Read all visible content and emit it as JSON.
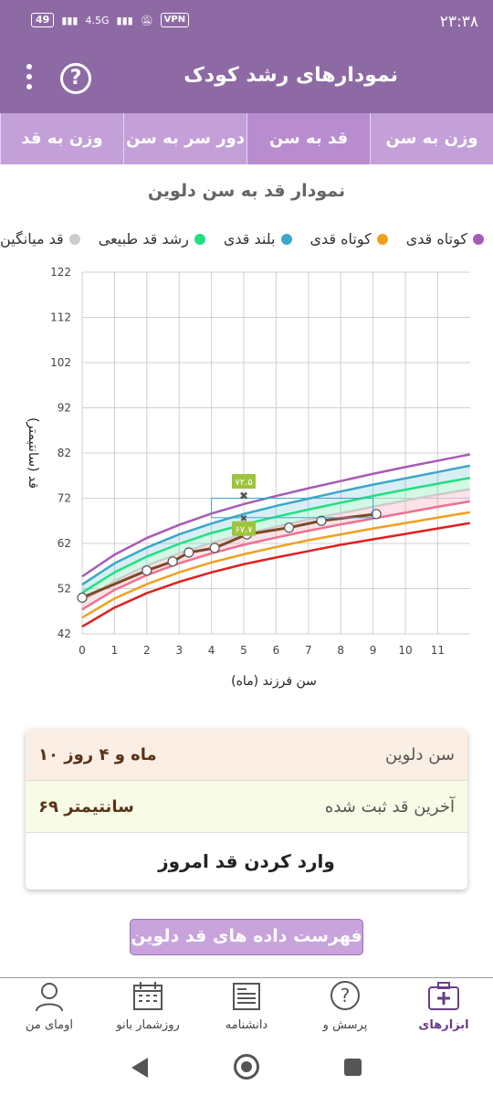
{
  "status_bar": {
    "time": "۲۳:۳۸",
    "battery": "49",
    "network": "4.5G",
    "vpn": "VPN"
  },
  "header": {
    "title": "نمودارهای رشد کودک"
  },
  "tabs": [
    {
      "label": "وزن به سن",
      "active": false
    },
    {
      "label": "قد به سن",
      "active": true
    },
    {
      "label": "دور سر به سن",
      "active": false
    },
    {
      "label": "وزن به قد",
      "active": false
    }
  ],
  "chart_title": "نمودار قد به سن دلوین",
  "legend": [
    {
      "label": "کوتاه قدی",
      "color": "#a65bb5"
    },
    {
      "label": "کوتاه قدی",
      "color": "#f0a020"
    },
    {
      "label": "بلند قدی",
      "color": "#3aa8c8"
    },
    {
      "label": "رشد قد طبیعی",
      "color": "#20e080"
    },
    {
      "label": "قد میانگین",
      "color": "#cccccc"
    }
  ],
  "chart_data": {
    "type": "line",
    "xlabel": "سن فرزند (ماه)",
    "ylabel": "قد (سانتیمتر)",
    "xlim": [
      0,
      12
    ],
    "ylim": [
      42,
      122
    ],
    "x_ticks": [
      "0",
      "1",
      "2",
      "3",
      "4",
      "5",
      "6",
      "7",
      "8",
      "9",
      "10",
      "11"
    ],
    "y_ticks": [
      "42",
      "52",
      "62",
      "72",
      "82",
      "92",
      "102",
      "112",
      "122"
    ],
    "series": [
      {
        "color": "#a65bb5",
        "x": [
          0,
          1,
          2,
          3,
          4,
          5,
          6,
          7,
          8,
          9,
          10,
          11,
          12
        ],
        "y": [
          54.7,
          59.5,
          63.2,
          66.1,
          68.6,
          70.7,
          72.5,
          74.2,
          75.8,
          77.4,
          78.9,
          80.3,
          81.7
        ]
      },
      {
        "color": "#3aa8c8",
        "x": [
          0,
          1,
          2,
          3,
          4,
          5,
          6,
          7,
          8,
          9,
          10,
          11,
          12
        ],
        "y": [
          52.9,
          57.6,
          61.1,
          64.0,
          66.4,
          68.5,
          70.3,
          71.9,
          73.5,
          75.0,
          76.4,
          77.8,
          79.2
        ]
      },
      {
        "color": "#20e080",
        "x": [
          0,
          1,
          2,
          3,
          4,
          5,
          6,
          7,
          8,
          9,
          10,
          11,
          12
        ],
        "y": [
          51.1,
          55.6,
          59.1,
          61.9,
          64.3,
          66.2,
          67.9,
          69.5,
          71.0,
          72.5,
          73.9,
          75.2,
          76.5
        ]
      },
      {
        "color": "#cccccc",
        "x": [
          0,
          1,
          2,
          3,
          4,
          5,
          6,
          7,
          8,
          9,
          10,
          11,
          12
        ],
        "y": [
          49.2,
          53.7,
          57.1,
          59.8,
          62.1,
          64.0,
          65.7,
          67.3,
          68.7,
          70.1,
          71.5,
          72.8,
          74.0
        ]
      },
      {
        "color": "#f07090",
        "x": [
          0,
          1,
          2,
          3,
          4,
          5,
          6,
          7,
          8,
          9,
          10,
          11,
          12
        ],
        "y": [
          47.4,
          51.7,
          55.0,
          57.6,
          59.8,
          61.7,
          63.3,
          64.8,
          66.2,
          67.5,
          68.8,
          70.1,
          71.3
        ]
      },
      {
        "color": "#f0a020",
        "x": [
          0,
          1,
          2,
          3,
          4,
          5,
          6,
          7,
          8,
          9,
          10,
          11,
          12
        ],
        "y": [
          45.6,
          49.8,
          53.0,
          55.6,
          57.8,
          59.6,
          61.2,
          62.7,
          64.0,
          65.3,
          66.5,
          67.7,
          68.9
        ]
      },
      {
        "color": "#e02020",
        "x": [
          0,
          1,
          2,
          3,
          4,
          5,
          6,
          7,
          8,
          9,
          10,
          11,
          12
        ],
        "y": [
          43.6,
          47.8,
          51.0,
          53.5,
          55.6,
          57.4,
          58.9,
          60.3,
          61.7,
          62.9,
          64.1,
          65.3,
          66.5
        ]
      },
      {
        "color": "#7a4a20",
        "x": [
          0,
          2,
          2.8,
          3.3,
          4.1,
          5.1,
          6.4,
          7.4,
          9.1
        ],
        "y": [
          50.0,
          56.0,
          58.0,
          60.0,
          61.0,
          64.0,
          65.5,
          67.0,
          68.5
        ]
      }
    ],
    "marker_labels": [
      "۷۲.۵",
      "۶۷.۷"
    ]
  },
  "info": {
    "age_label": "سن دلوین",
    "age_value": "۱۰ ماه و ۴ روز",
    "height_label": "آخرین قد ثبت شده",
    "height_value": "۶۹ سانتیمتر",
    "enter_button": "وارد کردن قد امروز"
  },
  "list_button": "فهرست داده های قد دلوین",
  "bottom_nav": [
    {
      "label": "ابزارهای",
      "icon": "medical-kit-icon",
      "active": true
    },
    {
      "label": "پرسش و",
      "icon": "question-icon",
      "active": false
    },
    {
      "label": "دانشنامه",
      "icon": "newspaper-icon",
      "active": false
    },
    {
      "label": "روزشمار بانو",
      "icon": "calendar-icon",
      "active": false
    },
    {
      "label": "اومای من",
      "icon": "profile-icon",
      "active": false
    }
  ]
}
